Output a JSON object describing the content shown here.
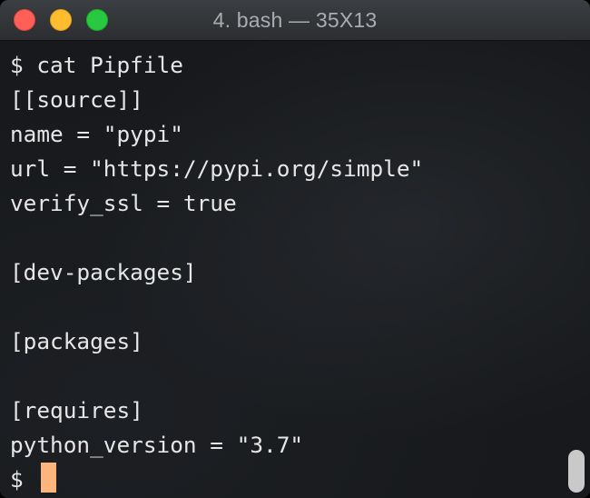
{
  "window": {
    "title": "4. bash — 35X13"
  },
  "terminal": {
    "lines": [
      "$ cat Pipfile",
      "[[source]]",
      "name = \"pypi\"",
      "url = \"https://pypi.org/simple\"",
      "verify_ssl = true",
      "",
      "[dev-packages]",
      "",
      "[packages]",
      "",
      "[requires]",
      "python_version = \"3.7\""
    ],
    "prompt": "$",
    "cursor_color": "#fbb57d"
  },
  "colors": {
    "close": "#fe5f57",
    "minimize": "#febc2e",
    "zoom": "#28c840"
  }
}
